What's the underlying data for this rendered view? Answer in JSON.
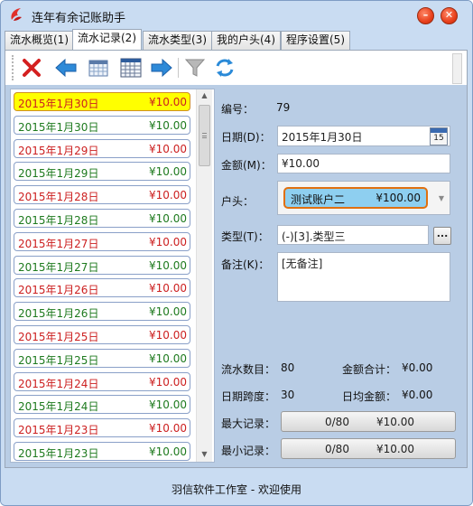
{
  "window": {
    "title": "连年有余记账助手",
    "minimize_glyph": "–",
    "close_glyph": "✕"
  },
  "tabs": [
    {
      "label": "流水概览(1)",
      "active": false
    },
    {
      "label": "流水记录(2)",
      "active": true
    },
    {
      "label": "流水类型(3)",
      "active": false
    },
    {
      "label": "我的户头(4)",
      "active": false
    },
    {
      "label": "程序设置(5)",
      "active": false
    }
  ],
  "toolbar": {
    "icons": [
      "delete-icon",
      "back-arrow-icon",
      "calendar-grid-icon",
      "calendar-table-icon",
      "forward-arrow-icon",
      "filter-icon",
      "refresh-icon"
    ]
  },
  "records": [
    {
      "date": "2015年1月30日",
      "amount": "¥10.00",
      "color": "#cc2020",
      "selected": true
    },
    {
      "date": "2015年1月30日",
      "amount": "¥10.00",
      "color": "#1e7a1e",
      "selected": false
    },
    {
      "date": "2015年1月29日",
      "amount": "¥10.00",
      "color": "#cc2020",
      "selected": false
    },
    {
      "date": "2015年1月29日",
      "amount": "¥10.00",
      "color": "#1e7a1e",
      "selected": false
    },
    {
      "date": "2015年1月28日",
      "amount": "¥10.00",
      "color": "#cc2020",
      "selected": false
    },
    {
      "date": "2015年1月28日",
      "amount": "¥10.00",
      "color": "#1e7a1e",
      "selected": false
    },
    {
      "date": "2015年1月27日",
      "amount": "¥10.00",
      "color": "#cc2020",
      "selected": false
    },
    {
      "date": "2015年1月27日",
      "amount": "¥10.00",
      "color": "#1e7a1e",
      "selected": false
    },
    {
      "date": "2015年1月26日",
      "amount": "¥10.00",
      "color": "#cc2020",
      "selected": false
    },
    {
      "date": "2015年1月26日",
      "amount": "¥10.00",
      "color": "#1e7a1e",
      "selected": false
    },
    {
      "date": "2015年1月25日",
      "amount": "¥10.00",
      "color": "#cc2020",
      "selected": false
    },
    {
      "date": "2015年1月25日",
      "amount": "¥10.00",
      "color": "#1e7a1e",
      "selected": false
    },
    {
      "date": "2015年1月24日",
      "amount": "¥10.00",
      "color": "#cc2020",
      "selected": false
    },
    {
      "date": "2015年1月24日",
      "amount": "¥10.00",
      "color": "#1e7a1e",
      "selected": false
    },
    {
      "date": "2015年1月23日",
      "amount": "¥10.00",
      "color": "#cc2020",
      "selected": false
    },
    {
      "date": "2015年1月23日",
      "amount": "¥10.00",
      "color": "#1e7a1e",
      "selected": false
    }
  ],
  "detail": {
    "id_label": "编号：",
    "id_value": "79",
    "date_label": "日期(D)：",
    "date_value": "2015年1月30日",
    "calendar_day": "15",
    "amount_label": "金额(M)：",
    "amount_value": "¥10.00",
    "account_label": "户头：",
    "account_name": "测试账户二",
    "account_balance": "¥100.00",
    "type_label": "类型(T)：",
    "type_value": "(-)[3].类型三",
    "type_button": "...",
    "note_label": "备注(K)：",
    "note_value": "[无备注]"
  },
  "stats": {
    "count_label": "流水数目：",
    "count_value": "80",
    "sum_label": "金额合计：",
    "sum_value": "¥0.00",
    "span_label": "日期跨度：",
    "span_value": "30",
    "daily_label": "日均金额：",
    "daily_value": "¥0.00",
    "max_label": "最大记录：",
    "max_index": "0/80",
    "max_amount": "¥10.00",
    "min_label": "最小记录：",
    "min_index": "0/80",
    "min_amount": "¥10.00"
  },
  "status": {
    "text": "羽信软件工作室 - 欢迎使用"
  },
  "colors": {
    "window_bg": "#c9dcf2",
    "content_bg": "#b9cde5",
    "expense_red": "#cc2020",
    "income_green": "#1e7a1e",
    "selected_yellow": "#ffff00",
    "account_chip": "#8ecff0"
  }
}
